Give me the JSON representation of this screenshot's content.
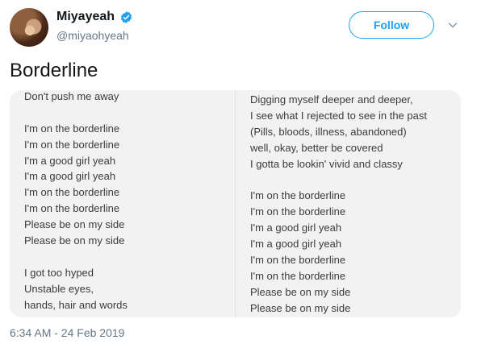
{
  "user": {
    "display_name": "Miyayeah",
    "handle": "@miyaohyeah",
    "follow_label": "Follow"
  },
  "tweet": {
    "text": "Borderline",
    "timestamp": "6:34 AM - 24 Feb 2019"
  },
  "lyrics": {
    "left": [
      "Don't push me away",
      "",
      "I'm on the borderline",
      "I'm on the borderline",
      "I'm a good girl yeah",
      "I'm a good girl yeah",
      "I'm on the borderline",
      "I'm on the borderline",
      "Please be on my side",
      "Please be on my side",
      "",
      "I got too hyped",
      "Unstable eyes,",
      "hands, hair and words"
    ],
    "right": [
      "Digging myself deeper and deeper,",
      "I see what I rejected to see in the past",
      "(Pills, bloods, illness, abandoned)",
      "well, okay, better be covered",
      "I gotta be lookin' vivid and classy",
      "",
      "I'm on the borderline",
      "I'm on the borderline",
      "I'm a good girl yeah",
      "I'm a good girl yeah",
      "I'm on the borderline",
      "I'm on the borderline",
      "Please be on my side",
      "Please be on my side"
    ]
  },
  "icons": {
    "verified": "verified-badge-icon",
    "more": "chevron-down-icon"
  },
  "colors": {
    "accent": "#1da1f2",
    "secondary_text": "#657786",
    "media_background": "#f2f2f2"
  }
}
